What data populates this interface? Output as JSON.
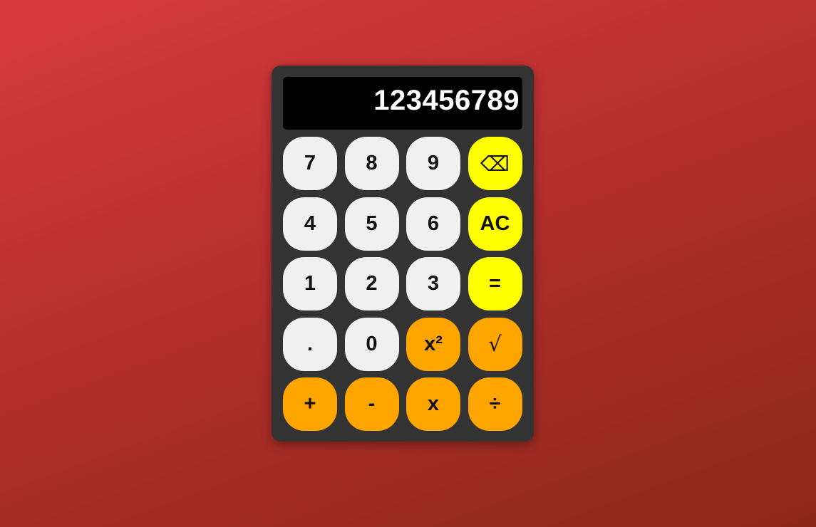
{
  "display": {
    "value": "123456789"
  },
  "colors": {
    "background_start": "#d93a3e",
    "background_end": "#8a2718",
    "body": "#333333",
    "display": "#000000",
    "number_key": "#f0f0f0",
    "utility_key": "#ffff00",
    "operator_key": "#ffa500"
  },
  "keys": [
    {
      "label": "7",
      "name": "key-7",
      "kind": "num"
    },
    {
      "label": "8",
      "name": "key-8",
      "kind": "num"
    },
    {
      "label": "9",
      "name": "key-9",
      "kind": "num"
    },
    {
      "label": "⌫",
      "name": "backspace-button",
      "kind": "util",
      "icon": "backspace-icon"
    },
    {
      "label": "4",
      "name": "key-4",
      "kind": "num"
    },
    {
      "label": "5",
      "name": "key-5",
      "kind": "num"
    },
    {
      "label": "6",
      "name": "key-6",
      "kind": "num"
    },
    {
      "label": "AC",
      "name": "all-clear-button",
      "kind": "util"
    },
    {
      "label": "1",
      "name": "key-1",
      "kind": "num"
    },
    {
      "label": "2",
      "name": "key-2",
      "kind": "num"
    },
    {
      "label": "3",
      "name": "key-3",
      "kind": "num"
    },
    {
      "label": "=",
      "name": "equals-button",
      "kind": "util"
    },
    {
      "label": ".",
      "name": "decimal-button",
      "kind": "num"
    },
    {
      "label": "0",
      "name": "key-0",
      "kind": "num"
    },
    {
      "label": "x²",
      "name": "square-button",
      "kind": "op"
    },
    {
      "label": "√",
      "name": "square-root-button",
      "kind": "op",
      "icon": "square-root-icon"
    },
    {
      "label": "+",
      "name": "add-button",
      "kind": "op"
    },
    {
      "label": "-",
      "name": "subtract-button",
      "kind": "op"
    },
    {
      "label": "x",
      "name": "multiply-button",
      "kind": "op"
    },
    {
      "label": "÷",
      "name": "divide-button",
      "kind": "op"
    }
  ]
}
